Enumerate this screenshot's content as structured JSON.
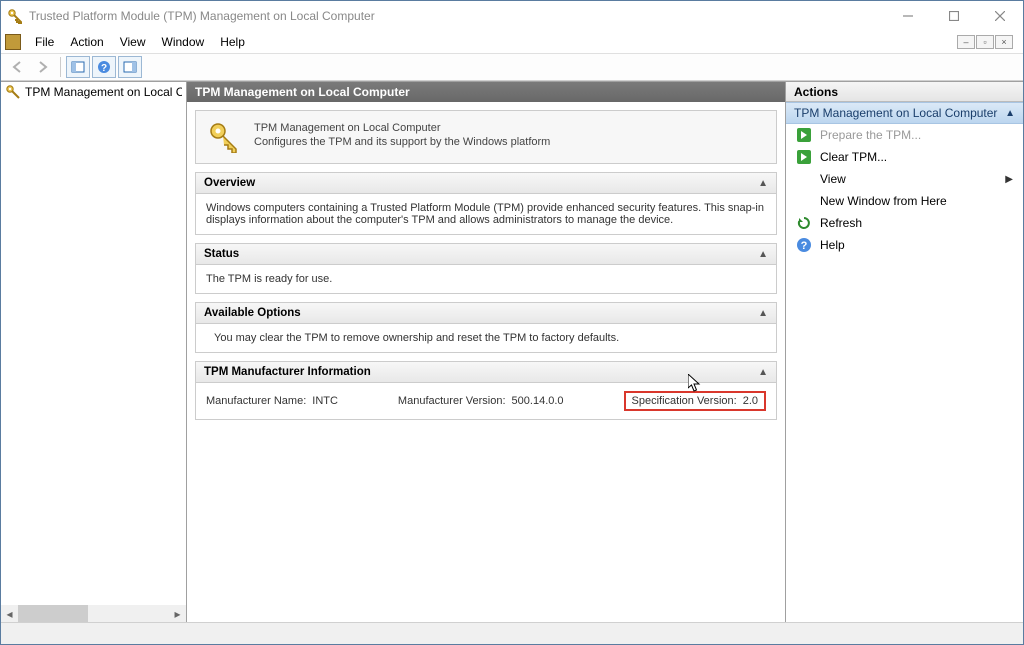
{
  "window": {
    "title": "Trusted Platform Module (TPM) Management on Local Computer"
  },
  "menu": {
    "file": "File",
    "action": "Action",
    "view": "View",
    "window": "Window",
    "help": "Help"
  },
  "tree": {
    "root": "TPM Management on Local Comp"
  },
  "center": {
    "header": "TPM Management on Local Computer",
    "intro_title": "TPM Management on Local Computer",
    "intro_sub": "Configures the TPM and its support by the Windows platform",
    "overview": {
      "title": "Overview",
      "body": "Windows computers containing a Trusted Platform Module (TPM) provide enhanced security features. This snap-in displays information about the computer's TPM and allows administrators to manage the device."
    },
    "status": {
      "title": "Status",
      "body": "The TPM is ready for use."
    },
    "options": {
      "title": "Available Options",
      "body": "You may clear the TPM to remove ownership and reset the TPM to factory defaults."
    },
    "mfg": {
      "title": "TPM Manufacturer Information",
      "name_label": "Manufacturer Name:",
      "name_value": "INTC",
      "ver_label": "Manufacturer Version:",
      "ver_value": "500.14.0.0",
      "spec_label": "Specification Version:",
      "spec_value": "2.0"
    }
  },
  "actions": {
    "header": "Actions",
    "group": "TPM Management on Local Computer",
    "prepare": "Prepare the TPM...",
    "clear": "Clear TPM...",
    "view": "View",
    "new_window": "New Window from Here",
    "refresh": "Refresh",
    "help": "Help"
  }
}
